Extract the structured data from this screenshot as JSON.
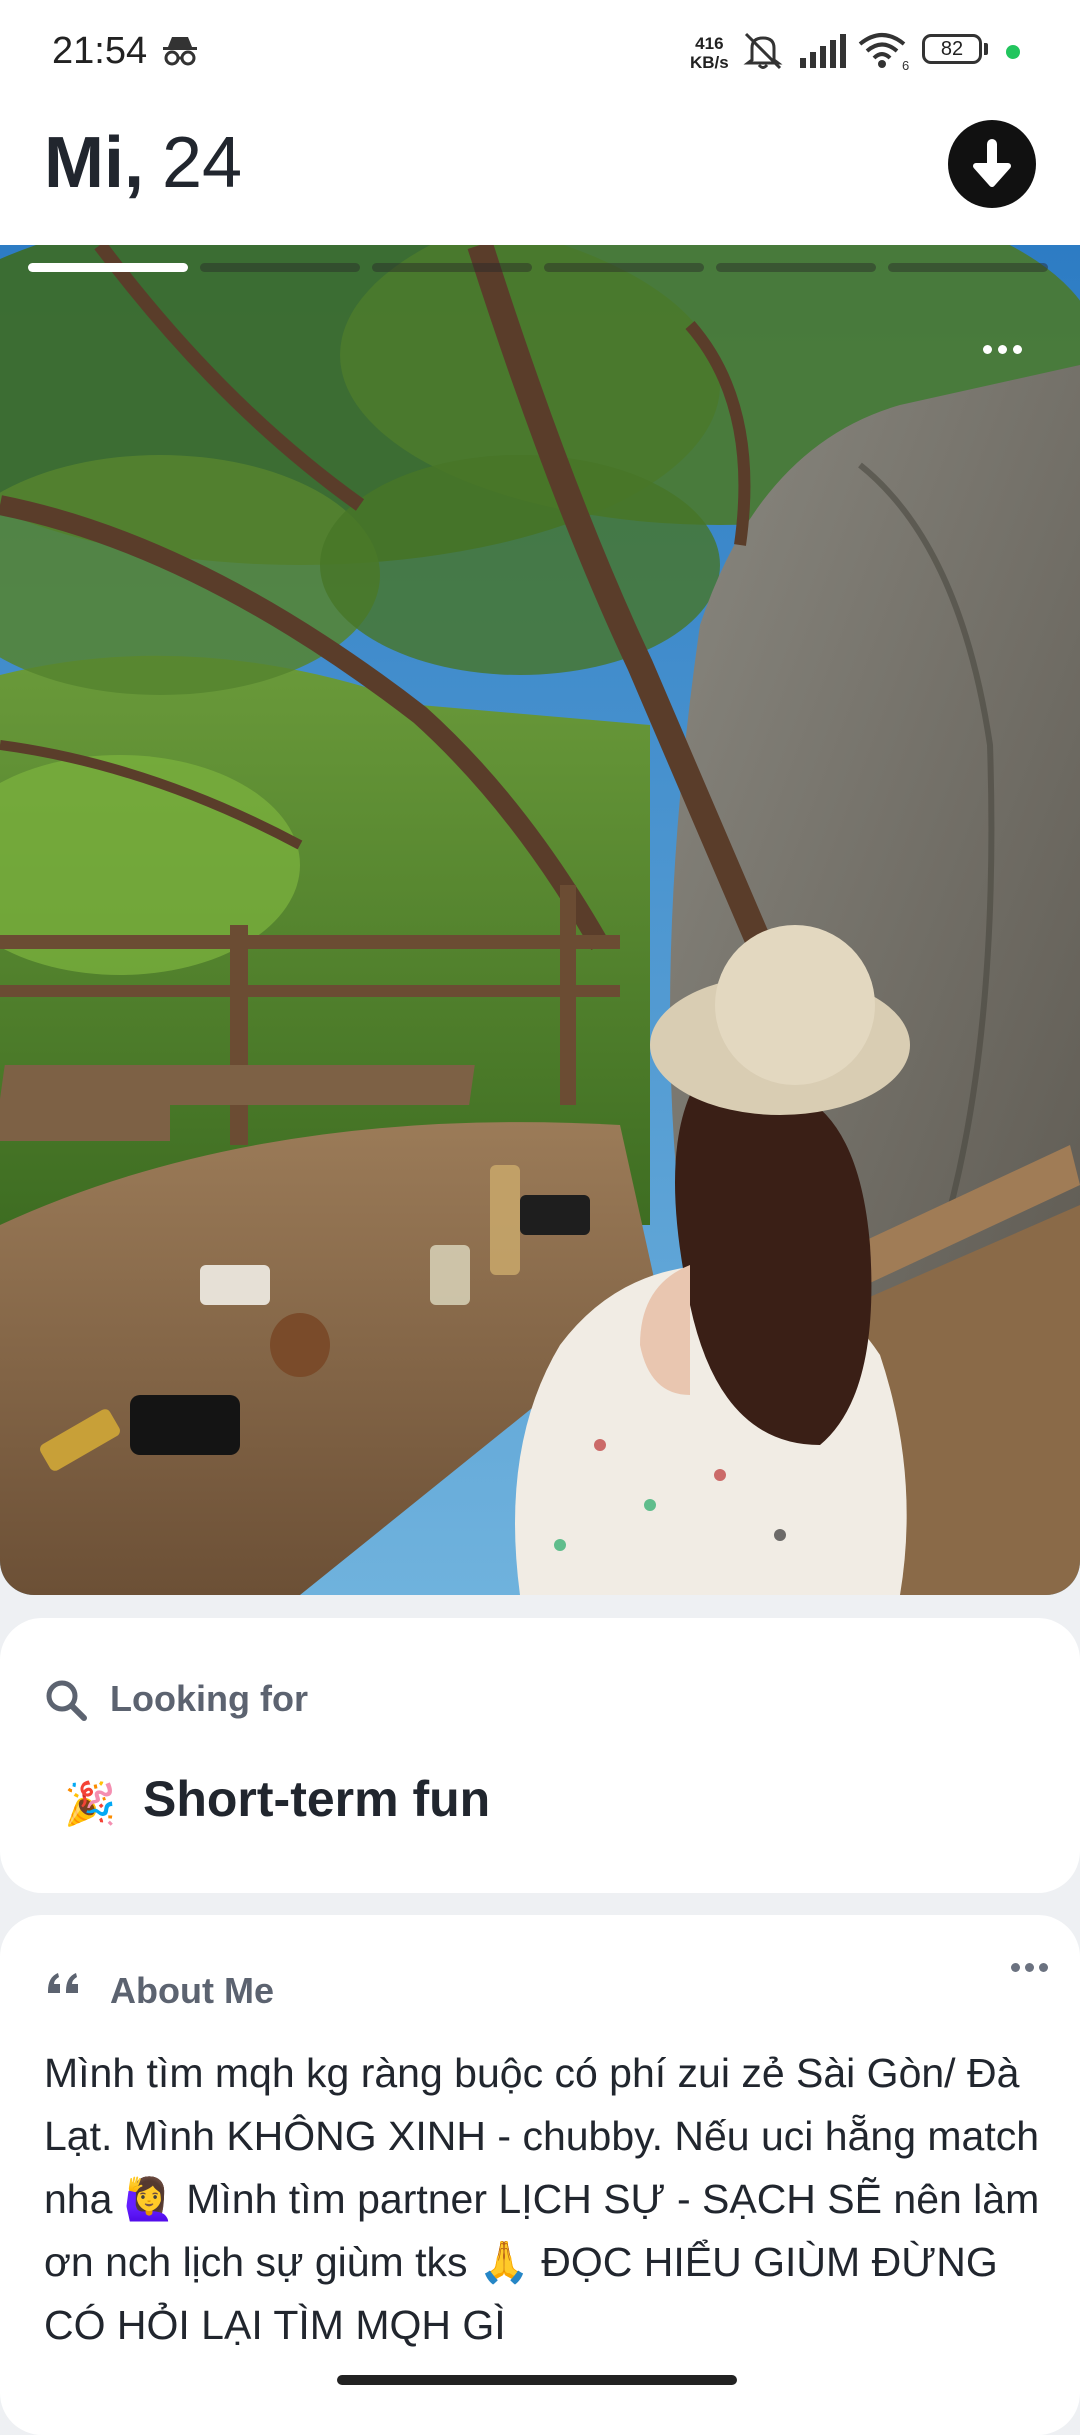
{
  "status_bar": {
    "time": "21:54",
    "net_speed_value": "416",
    "net_speed_unit": "KB/s",
    "battery": "82",
    "wifi_badge": "6"
  },
  "profile": {
    "name": "Mi,",
    "age": "24",
    "photo_count": 6,
    "active_photo_index": 1
  },
  "looking_for": {
    "label": "Looking for",
    "emoji": "🎉",
    "value": "Short-term fun"
  },
  "about": {
    "label": "About Me",
    "text": "Mình tìm mqh kg ràng buộc có phí zui zẻ Sài Gòn/ Đà Lạt. Mình KHÔNG XINH - chubby. Nếu uci hẵng match nha 🙋‍♀️ Mình tìm partner LỊCH SỰ - SẠCH SẼ nên làm ơn nch lịch sự giùm tks 🙏 ĐỌC HIỂU GIÙM ĐỪNG CÓ HỎI LẠI TÌM MQH GÌ"
  },
  "icons": {
    "incognito": "incognito-icon",
    "mute": "notifications-off-icon",
    "signal": "signal-icon",
    "wifi": "wifi-icon",
    "collapse": "arrow-down-icon",
    "search": "search-icon",
    "quote": "quote-icon",
    "more": "more-dots-icon"
  },
  "colors": {
    "accent_dot": "#22c55e",
    "page_background": "#eef0f3",
    "label_gray": "#5c6370",
    "text": "#21262e"
  }
}
